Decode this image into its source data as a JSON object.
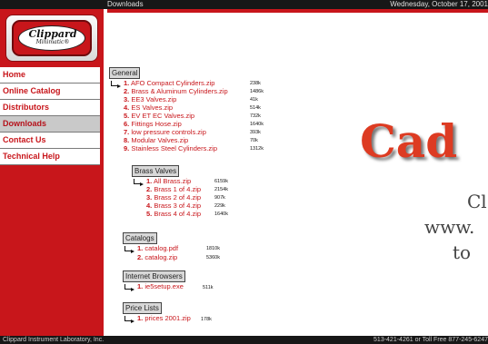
{
  "header": {
    "page_title": "Downloads",
    "date": "Wednesday, October 17, 2001"
  },
  "logo": {
    "name": "Clippard",
    "tagline": "Minimatic®"
  },
  "nav": {
    "items": [
      {
        "label": "Home"
      },
      {
        "label": "Online Catalog"
      },
      {
        "label": "Distributors"
      },
      {
        "label": "Downloads"
      },
      {
        "label": "Contact Us"
      },
      {
        "label": "Technical Help"
      }
    ]
  },
  "sections": {
    "general": {
      "title": "General",
      "files": [
        {
          "num": "1.",
          "name": "AFO Compact Cylinders.zip",
          "size": "238k"
        },
        {
          "num": "2.",
          "name": "Brass & Aluminum Cylinders.zip",
          "size": "1486k"
        },
        {
          "num": "3.",
          "name": "EE3 Valves.zip",
          "size": "41k"
        },
        {
          "num": "4.",
          "name": "ES Valves.zip",
          "size": "514k"
        },
        {
          "num": "5.",
          "name": "EV ET EC Valves.zip",
          "size": "732k"
        },
        {
          "num": "6.",
          "name": "Fittings Hose.zip",
          "size": "1640k"
        },
        {
          "num": "7.",
          "name": "low pressure controls.zip",
          "size": "393k"
        },
        {
          "num": "8.",
          "name": "Modular Valves.zip",
          "size": "70k"
        },
        {
          "num": "9.",
          "name": "Stainless Steel Cylinders.zip",
          "size": "1312k"
        }
      ]
    },
    "brass": {
      "title": "Brass Valves",
      "files": [
        {
          "num": "1.",
          "name": "All Brass.zip",
          "size": "6159k"
        },
        {
          "num": "2.",
          "name": "Brass 1 of 4.zip",
          "size": "2154k"
        },
        {
          "num": "3.",
          "name": "Brass 2 of 4.zip",
          "size": "907k"
        },
        {
          "num": "4.",
          "name": "Brass 3 of 4.zip",
          "size": "229k"
        },
        {
          "num": "5.",
          "name": "Brass 4 of 4.zip",
          "size": "1640k"
        }
      ]
    },
    "catalogs": {
      "title": "Catalogs",
      "files": [
        {
          "num": "1.",
          "name": "catalog.pdf",
          "size": "1810k"
        },
        {
          "num": "2.",
          "name": "catalog.zip",
          "size": "5360k"
        }
      ]
    },
    "browsers": {
      "title": "Internet Browsers",
      "files": [
        {
          "num": "1.",
          "name": "ie5setup.exe",
          "size": "511k"
        }
      ]
    },
    "prices": {
      "title": "Price Lists",
      "files": [
        {
          "num": "1.",
          "name": "prices 2001.zip",
          "size": "178k"
        }
      ]
    }
  },
  "promo": {
    "heading": "Cad",
    "line1": "Cl",
    "line2": "www.",
    "line3": "to"
  },
  "footer": {
    "left": "Clippard Instrument Laboratory, Inc.",
    "right": "513-421-4261 or Toll Free 877-245-6247"
  },
  "colors": {
    "brand_red": "#c8161b",
    "cad_orange": "#dd3b22",
    "bar_black": "#171717"
  }
}
